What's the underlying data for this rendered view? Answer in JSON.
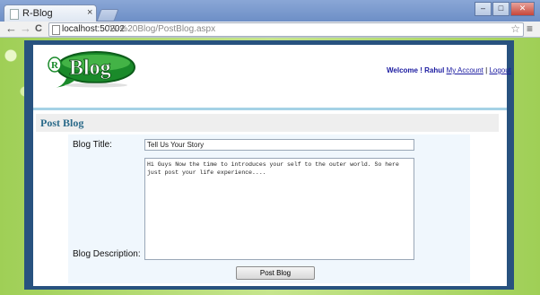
{
  "browser": {
    "tab_title": "R-Blog",
    "tab_close": "×",
    "address_host": "localhost:50202",
    "address_path": "/R-%20Blog/PostBlog.aspx",
    "back": "←",
    "forward": "→",
    "reload": "C",
    "star": "☆",
    "menu": "≡",
    "minimize": "–",
    "maximize": "□",
    "close": "✕"
  },
  "site": {
    "logo_text": "Blog",
    "logo_prefix": "R",
    "welcome_prefix": "Welcome ! Rahul",
    "my_account_link": "My Account",
    "separator": " | ",
    "logout_link": "Logout"
  },
  "form": {
    "section_title": "Post Blog",
    "title_label": "Blog Title:",
    "title_value": "Tell Us Your Story",
    "description_label": "Blog Description:",
    "description_value": "Hi Guys Now the time to introduces your self to the outer world. So here just post your life experience....",
    "submit_label": "Post Blog"
  },
  "colors": {
    "frame": "#28527f",
    "section_title": "#2c6b8a",
    "link": "#1a1aa0"
  }
}
